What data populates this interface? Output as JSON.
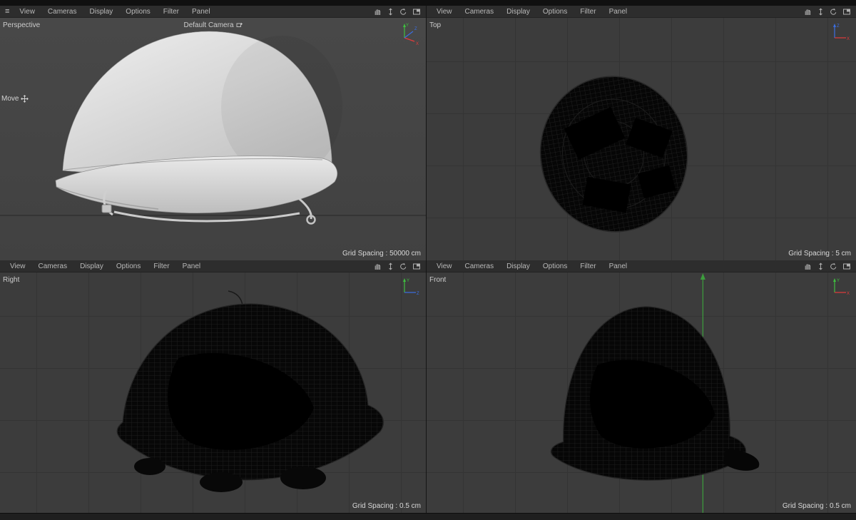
{
  "app": {
    "menu_icon": "≡",
    "menu": [
      "View",
      "Cameras",
      "Display",
      "Options",
      "Filter",
      "Panel"
    ]
  },
  "axis": {
    "x": "X",
    "y": "Y",
    "z": "Z"
  },
  "colors": {
    "axis_x": "#e23b3b",
    "axis_y": "#3fbf3f",
    "axis_z": "#3b6ee2",
    "viewport_bg": "#3c3c3c",
    "menubar_bg": "#2d2d2d",
    "front_axis_line": "#3d9e3d"
  },
  "viewports": {
    "perspective": {
      "label": "Perspective",
      "camera": "Default Camera",
      "tool_hint": "Move",
      "grid_spacing": "Grid Spacing : 50000 cm"
    },
    "top": {
      "label": "Top",
      "grid_spacing": "Grid Spacing : 5 cm"
    },
    "right": {
      "label": "Right",
      "grid_spacing": "Grid Spacing : 0.5 cm"
    },
    "front": {
      "label": "Front",
      "grid_spacing": "Grid Spacing : 0.5 cm"
    }
  }
}
